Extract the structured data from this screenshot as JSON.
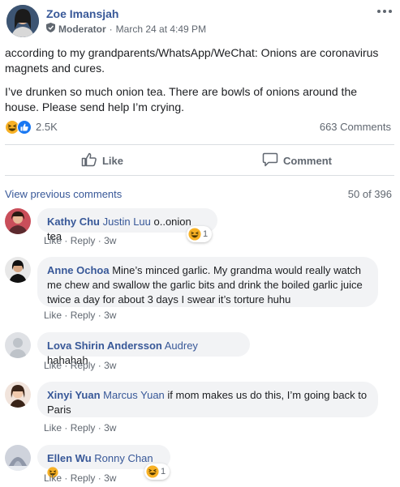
{
  "post": {
    "author": "Zoe Imansjah",
    "role": "Moderator",
    "date_sep": "·",
    "date": "March 24 at 4:49 PM",
    "paragraphs": [
      "according to my grandparents/WhatsApp/WeChat: Onions are coronavirus magnets and cures.",
      "I’ve drunken so much onion tea. There are bowls of onions around the house. Please send help I’m crying."
    ],
    "reaction_count": "2.5K",
    "comment_count": "663 Comments"
  },
  "actions": {
    "like": "Like",
    "comment": "Comment"
  },
  "comments_section": {
    "view_previous": "View previous comments",
    "page": "50 of 396"
  },
  "comment_actions": {
    "like": "Like",
    "reply": "Reply",
    "sep": "·",
    "time": "3w"
  },
  "comments": [
    {
      "name": "Kathy Chu",
      "mention": "Justin Luu",
      "text": " o..onion tea",
      "reactions": "1"
    },
    {
      "name": "Anne Ochoa",
      "mention": "",
      "text": "Mine’s minced garlic. My grandma would really watch me chew and swallow the garlic bits and drink the boiled garlic juice twice a day for about 3 days I swear it’s torture huhu"
    },
    {
      "name": "Lova Shirin Andersson",
      "mention": "Audrey",
      "text": " hahahah"
    },
    {
      "name": "Xinyi Yuan",
      "mention": "Marcus Yuan",
      "text": " if mom makes us do this, I’m going back to Paris"
    },
    {
      "name": "Ellen Wu",
      "mention": "Ronny Chan",
      "text": "",
      "reactions": "1"
    }
  ],
  "colors": {
    "link": "#385898",
    "muted": "#606770",
    "bubble": "#f2f3f5",
    "like_blue": "#1877f2",
    "haha_yellow": "#f7b125"
  },
  "icons": [
    "more-icon",
    "moderator-shield-icon",
    "haha-reaction-icon",
    "like-reaction-icon",
    "like-thumb-icon",
    "comment-bubble-icon",
    "default-avatar-icon"
  ]
}
